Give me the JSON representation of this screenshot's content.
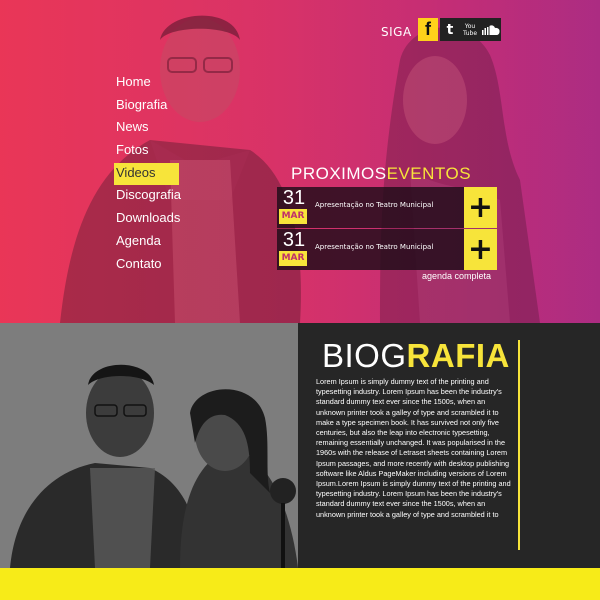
{
  "header": {
    "follow_label": "SIGA"
  },
  "social": [
    {
      "icon": "facebook-icon",
      "glyph": "f"
    },
    {
      "icon": "twitter-icon",
      "glyph": "t"
    },
    {
      "icon": "youtube-icon",
      "glyph": "You Tube"
    },
    {
      "icon": "soundcloud-icon"
    }
  ],
  "nav": {
    "items": [
      "Home",
      "Biografia",
      "News",
      "Fotos",
      "Videos",
      "Discografia",
      "Downloads",
      "Agenda",
      "Contato"
    ],
    "active": "Videos"
  },
  "events": {
    "title_part1": "PROXIMOS",
    "title_part2": "EVENTOS",
    "items": [
      {
        "day": "31",
        "month": "MAR",
        "description": "Apresentação no Teatro Municipal"
      },
      {
        "day": "31",
        "month": "MAR",
        "description": "Apresentação no Teatro Municipal"
      }
    ],
    "add_symbol": "+",
    "agenda_link": "agenda completa"
  },
  "bio": {
    "title_part1": "BIOG",
    "title_part2": "RAFIA",
    "text": "Lorem Ipsum is simply dummy text of the printing and typesetting industry. Lorem Ipsum has been the industry's standard dummy text ever since the 1500s, when an unknown printer took a galley of type and scrambled it to make a type specimen book. It has survived not only five centuries, but also the leap into electronic typesetting, remaining essentially unchanged. It was popularised in the 1960s with the release of Letraset sheets containing Lorem Ipsum passages, and more recently with desktop publishing software like Aldus PageMaker including versions of Lorem Ipsum.Lorem Ipsum is simply dummy text of the printing and typesetting industry. Lorem Ipsum has been the industry's standard dummy text ever since the 1500s, when an unknown printer took a galley of type and scrambled it to"
  },
  "colors": {
    "accent": "#f7e43a",
    "hero_pink": "#e8365a",
    "hero_magenta": "#a92e86",
    "panel_dark": "#262626"
  }
}
